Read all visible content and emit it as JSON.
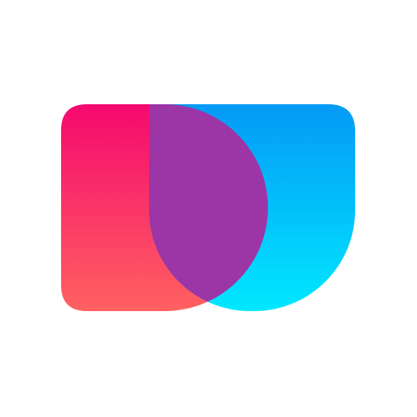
{
  "logo": {
    "icon_name": "overlapping-d-shapes-logo",
    "colors": {
      "pink_top": "#F5096E",
      "coral_bottom": "#FF6161",
      "blue_top": "#0599F5",
      "cyan_bottom": "#00E8FF",
      "overlap_purple": "#9C35A6"
    }
  }
}
